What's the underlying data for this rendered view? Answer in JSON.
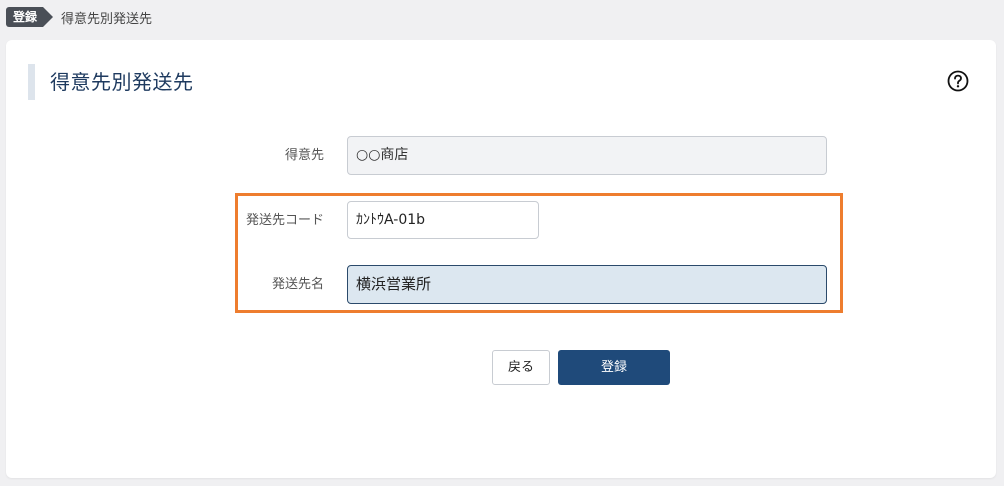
{
  "breadcrumb": {
    "tag": "登録",
    "current": "得意先別発送先"
  },
  "page": {
    "title": "得意先別発送先",
    "help_icon": "question-circle-icon"
  },
  "form": {
    "customer": {
      "label": "得意先",
      "value": "○○商店"
    },
    "ship_code": {
      "label": "発送先コード",
      "value": "ｶﾝﾄｳA-01b"
    },
    "ship_name": {
      "label": "発送先名",
      "value": "横浜営業所"
    }
  },
  "buttons": {
    "back": "戻る",
    "register": "登録"
  },
  "colors": {
    "highlight": "#ee7d2e",
    "primary": "#1f4a7a",
    "title": "#1e3a5f"
  }
}
